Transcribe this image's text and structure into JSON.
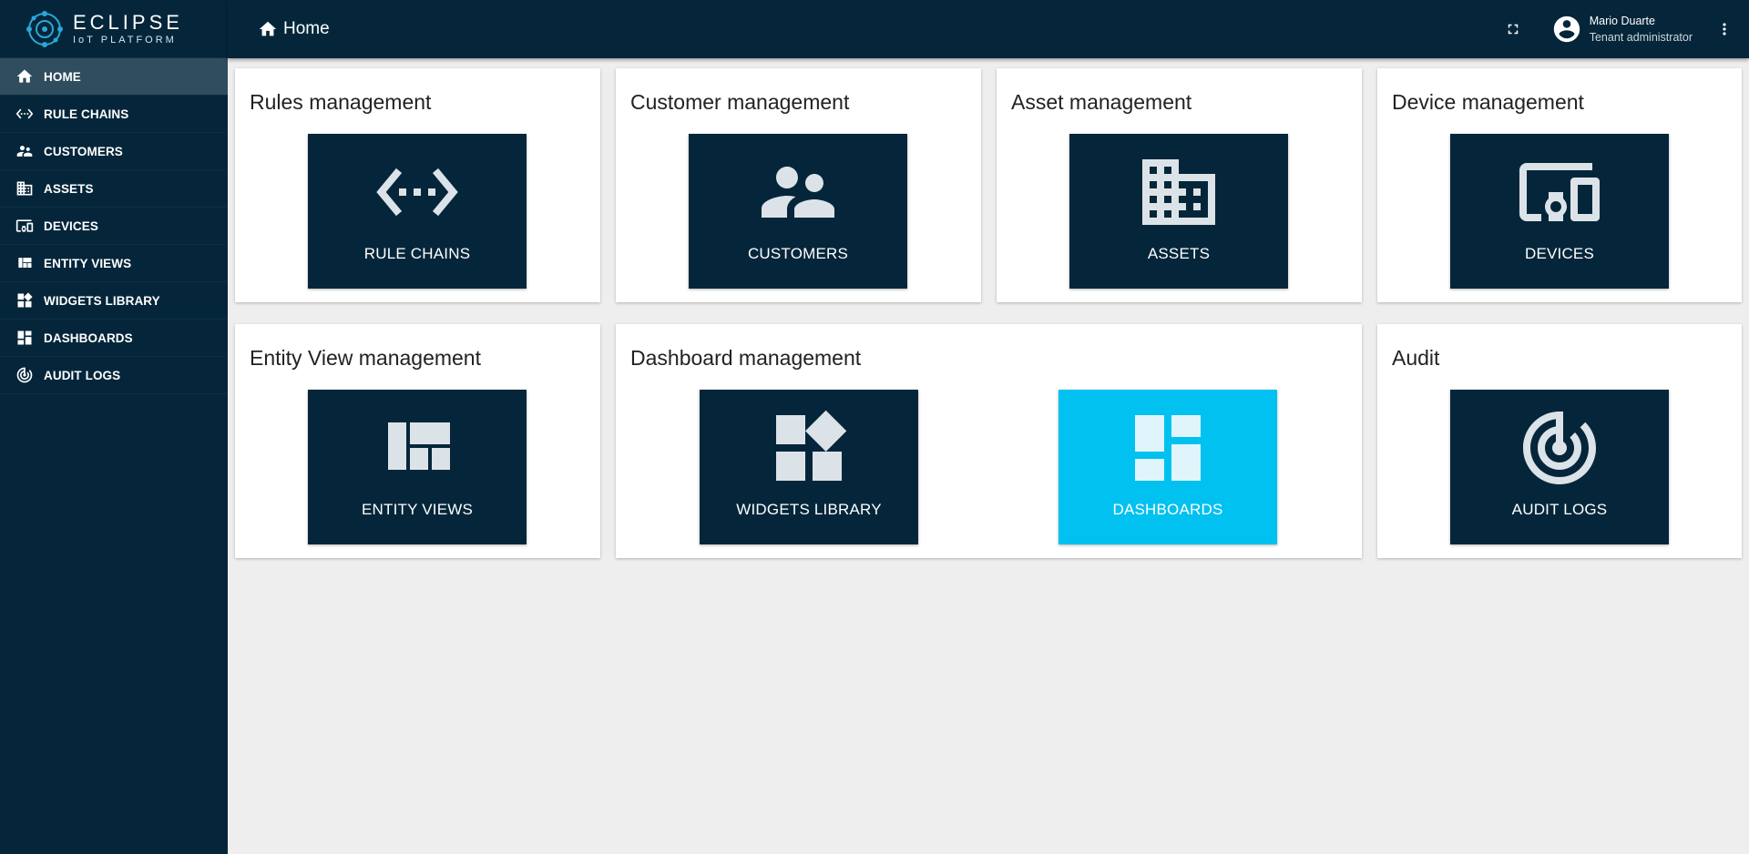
{
  "app": {
    "logo_main": "ECLIPSE",
    "logo_sub": "IoT PLATFORM"
  },
  "sidebar": {
    "items": [
      {
        "label": "HOME",
        "icon": "home-icon",
        "active": true
      },
      {
        "label": "RULE CHAINS",
        "icon": "settings-ethernet-icon"
      },
      {
        "label": "CUSTOMERS",
        "icon": "supervisor-account-icon"
      },
      {
        "label": "ASSETS",
        "icon": "domain-icon"
      },
      {
        "label": "DEVICES",
        "icon": "devices-other-icon"
      },
      {
        "label": "ENTITY VIEWS",
        "icon": "view-quilt-icon"
      },
      {
        "label": "WIDGETS LIBRARY",
        "icon": "widgets-icon"
      },
      {
        "label": "DASHBOARDS",
        "icon": "dashboard-icon"
      },
      {
        "label": "AUDIT LOGS",
        "icon": "track-changes-icon"
      }
    ]
  },
  "header": {
    "breadcrumb": "Home",
    "user_name": "Mario Duarte",
    "user_role": "Tenant administrator"
  },
  "cards": {
    "rules": {
      "title": "Rules management",
      "tile": "RULE CHAINS"
    },
    "customers": {
      "title": "Customer management",
      "tile": "CUSTOMERS"
    },
    "assets": {
      "title": "Asset management",
      "tile": "ASSETS"
    },
    "devices": {
      "title": "Device management",
      "tile": "DEVICES"
    },
    "entity_views": {
      "title": "Entity View management",
      "tile": "ENTITY VIEWS"
    },
    "dashboards": {
      "title": "Dashboard management",
      "tile_widgets": "WIDGETS LIBRARY",
      "tile_dashboards": "DASHBOARDS"
    },
    "audit": {
      "title": "Audit",
      "tile": "AUDIT LOGS"
    }
  },
  "colors": {
    "primary_dark": "#05263a",
    "accent": "#00c1f0",
    "background": "#eeeeee"
  }
}
